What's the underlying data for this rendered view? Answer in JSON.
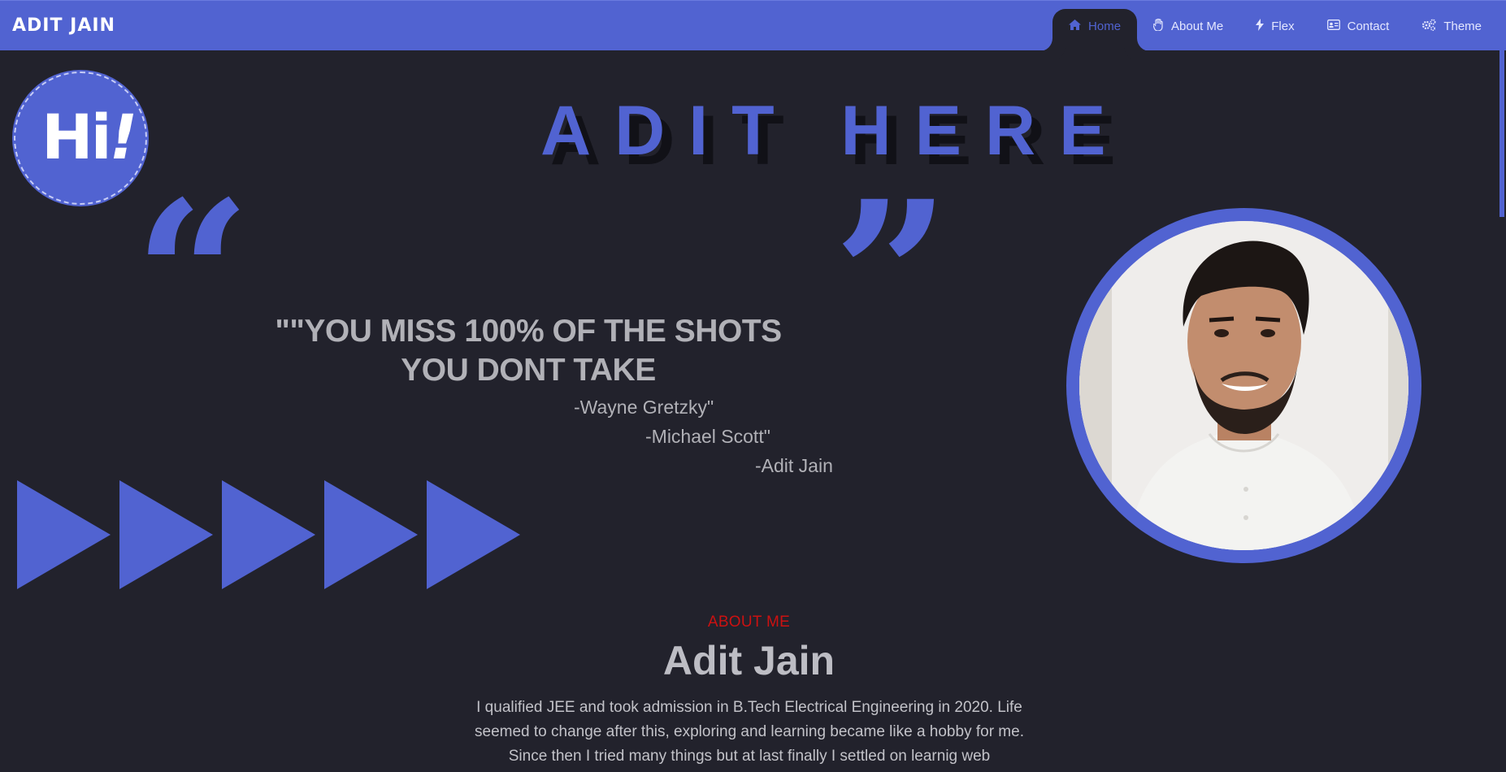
{
  "header": {
    "brand": "ADIT JAIN",
    "nav": [
      {
        "label": "Home",
        "icon": "home-icon",
        "active": true
      },
      {
        "label": "About Me",
        "icon": "hand-icon",
        "active": false
      },
      {
        "label": "Flex",
        "icon": "bolt-icon",
        "active": false
      },
      {
        "label": "Contact",
        "icon": "contact-card-icon",
        "active": false
      },
      {
        "label": "Theme",
        "icon": "gears-icon",
        "active": false
      }
    ]
  },
  "hero": {
    "badge": "Hi",
    "badge_mark": "!",
    "headline": "ADIT HERE",
    "quote_open": "“",
    "quote_close": "”",
    "quote": "\"\"YOU MISS 100% OF THE SHOTS YOU DONT TAKE",
    "attributions": [
      "-Wayne Gretzky\"",
      "-Michael Scott\"",
      "-Adit Jain"
    ]
  },
  "about": {
    "label": "ABOUT ME",
    "name": "Adit Jain",
    "text": "I qualified JEE and took admission in B.Tech Electrical Engineering in 2020. Life seemed to change after this, exploring and learning became like a hobby for me. Since then I tried many things but at last finally I settled on learnig web"
  },
  "colors": {
    "accent": "#5163d1",
    "background": "#22222c",
    "about_label": "#cc1111"
  }
}
